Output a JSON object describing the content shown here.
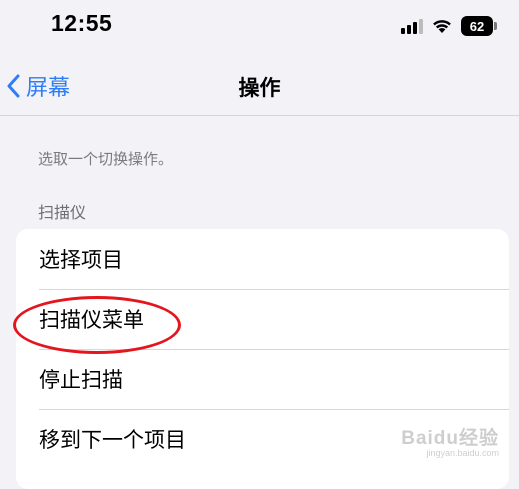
{
  "status_bar": {
    "time": "12:55",
    "battery": "62"
  },
  "nav": {
    "back_label": "屏幕",
    "title": "操作"
  },
  "hint": "选取一个切换操作。",
  "section": {
    "header": "扫描仪",
    "items": [
      {
        "label": "选择项目"
      },
      {
        "label": "扫描仪菜单"
      },
      {
        "label": "停止扫描"
      },
      {
        "label": "移到下一个项目"
      }
    ]
  },
  "annotation": {
    "color": "#e3161e",
    "target": "扫描仪菜单"
  },
  "watermark": {
    "main": "Baidu经验",
    "sub": "jingyan.baidu.com"
  }
}
